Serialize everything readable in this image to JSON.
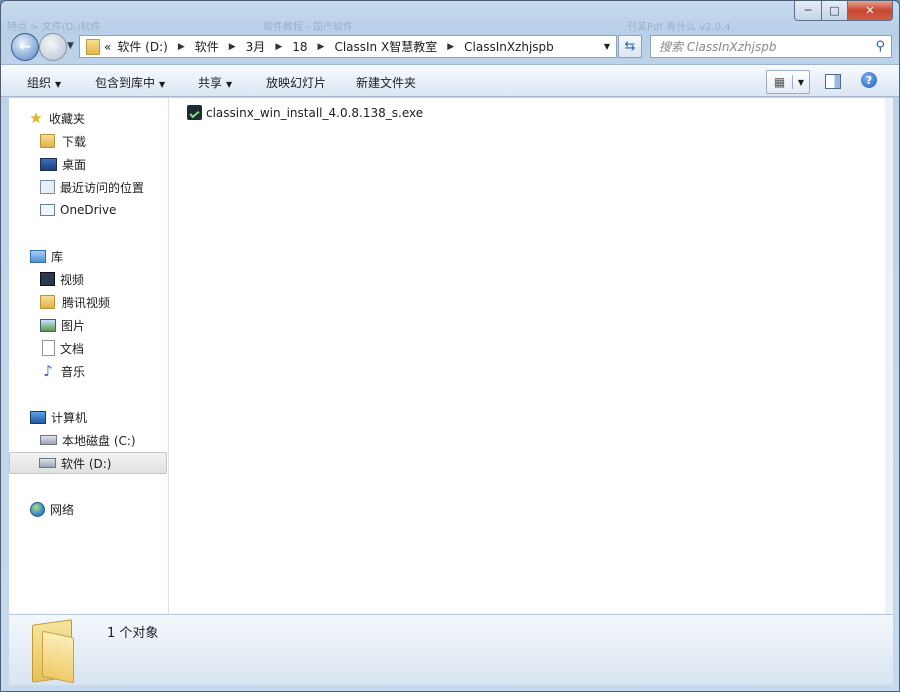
{
  "window": {
    "ghost_left": "特点 > 文件(D:)软件",
    "ghost_center": "软件教程 - 国产软件",
    "ghost_right": "刊某Pdf 有什么 v2.0.4",
    "controls": {
      "minimize": "─",
      "maximize": "□",
      "close": "✕"
    }
  },
  "address": {
    "prefix": "«",
    "crumbs": [
      "软件 (D:)",
      "软件",
      "3月",
      "18",
      "ClassIn X智慧教室",
      "ClassInXzhjspb"
    ]
  },
  "search": {
    "placeholder": "搜索 ClassInXzhjspb"
  },
  "toolbar": {
    "organize": "组织",
    "include_in_library": "包含到库中",
    "share": "共享",
    "slideshow": "放映幻灯片",
    "new_folder": "新建文件夹"
  },
  "sidebar": {
    "favorites_header": "收藏夹",
    "favorites": [
      "下载",
      "桌面",
      "最近访问的位置",
      "OneDrive"
    ],
    "libraries_header": "库",
    "libraries": [
      "视频",
      "腾讯视频",
      "图片",
      "文档",
      "音乐"
    ],
    "computer_header": "计算机",
    "drives": [
      "本地磁盘 (C:)",
      "软件 (D:)"
    ],
    "network_header": "网络"
  },
  "files": [
    {
      "name": "classinx_win_install_4.0.8.138_s.exe",
      "icon": "exe-icon"
    }
  ],
  "status": {
    "count": "1 个对象"
  },
  "colors": {
    "chrome": "#bdd3ea",
    "selection": "#e1e1e1",
    "close": "#c7452e"
  }
}
